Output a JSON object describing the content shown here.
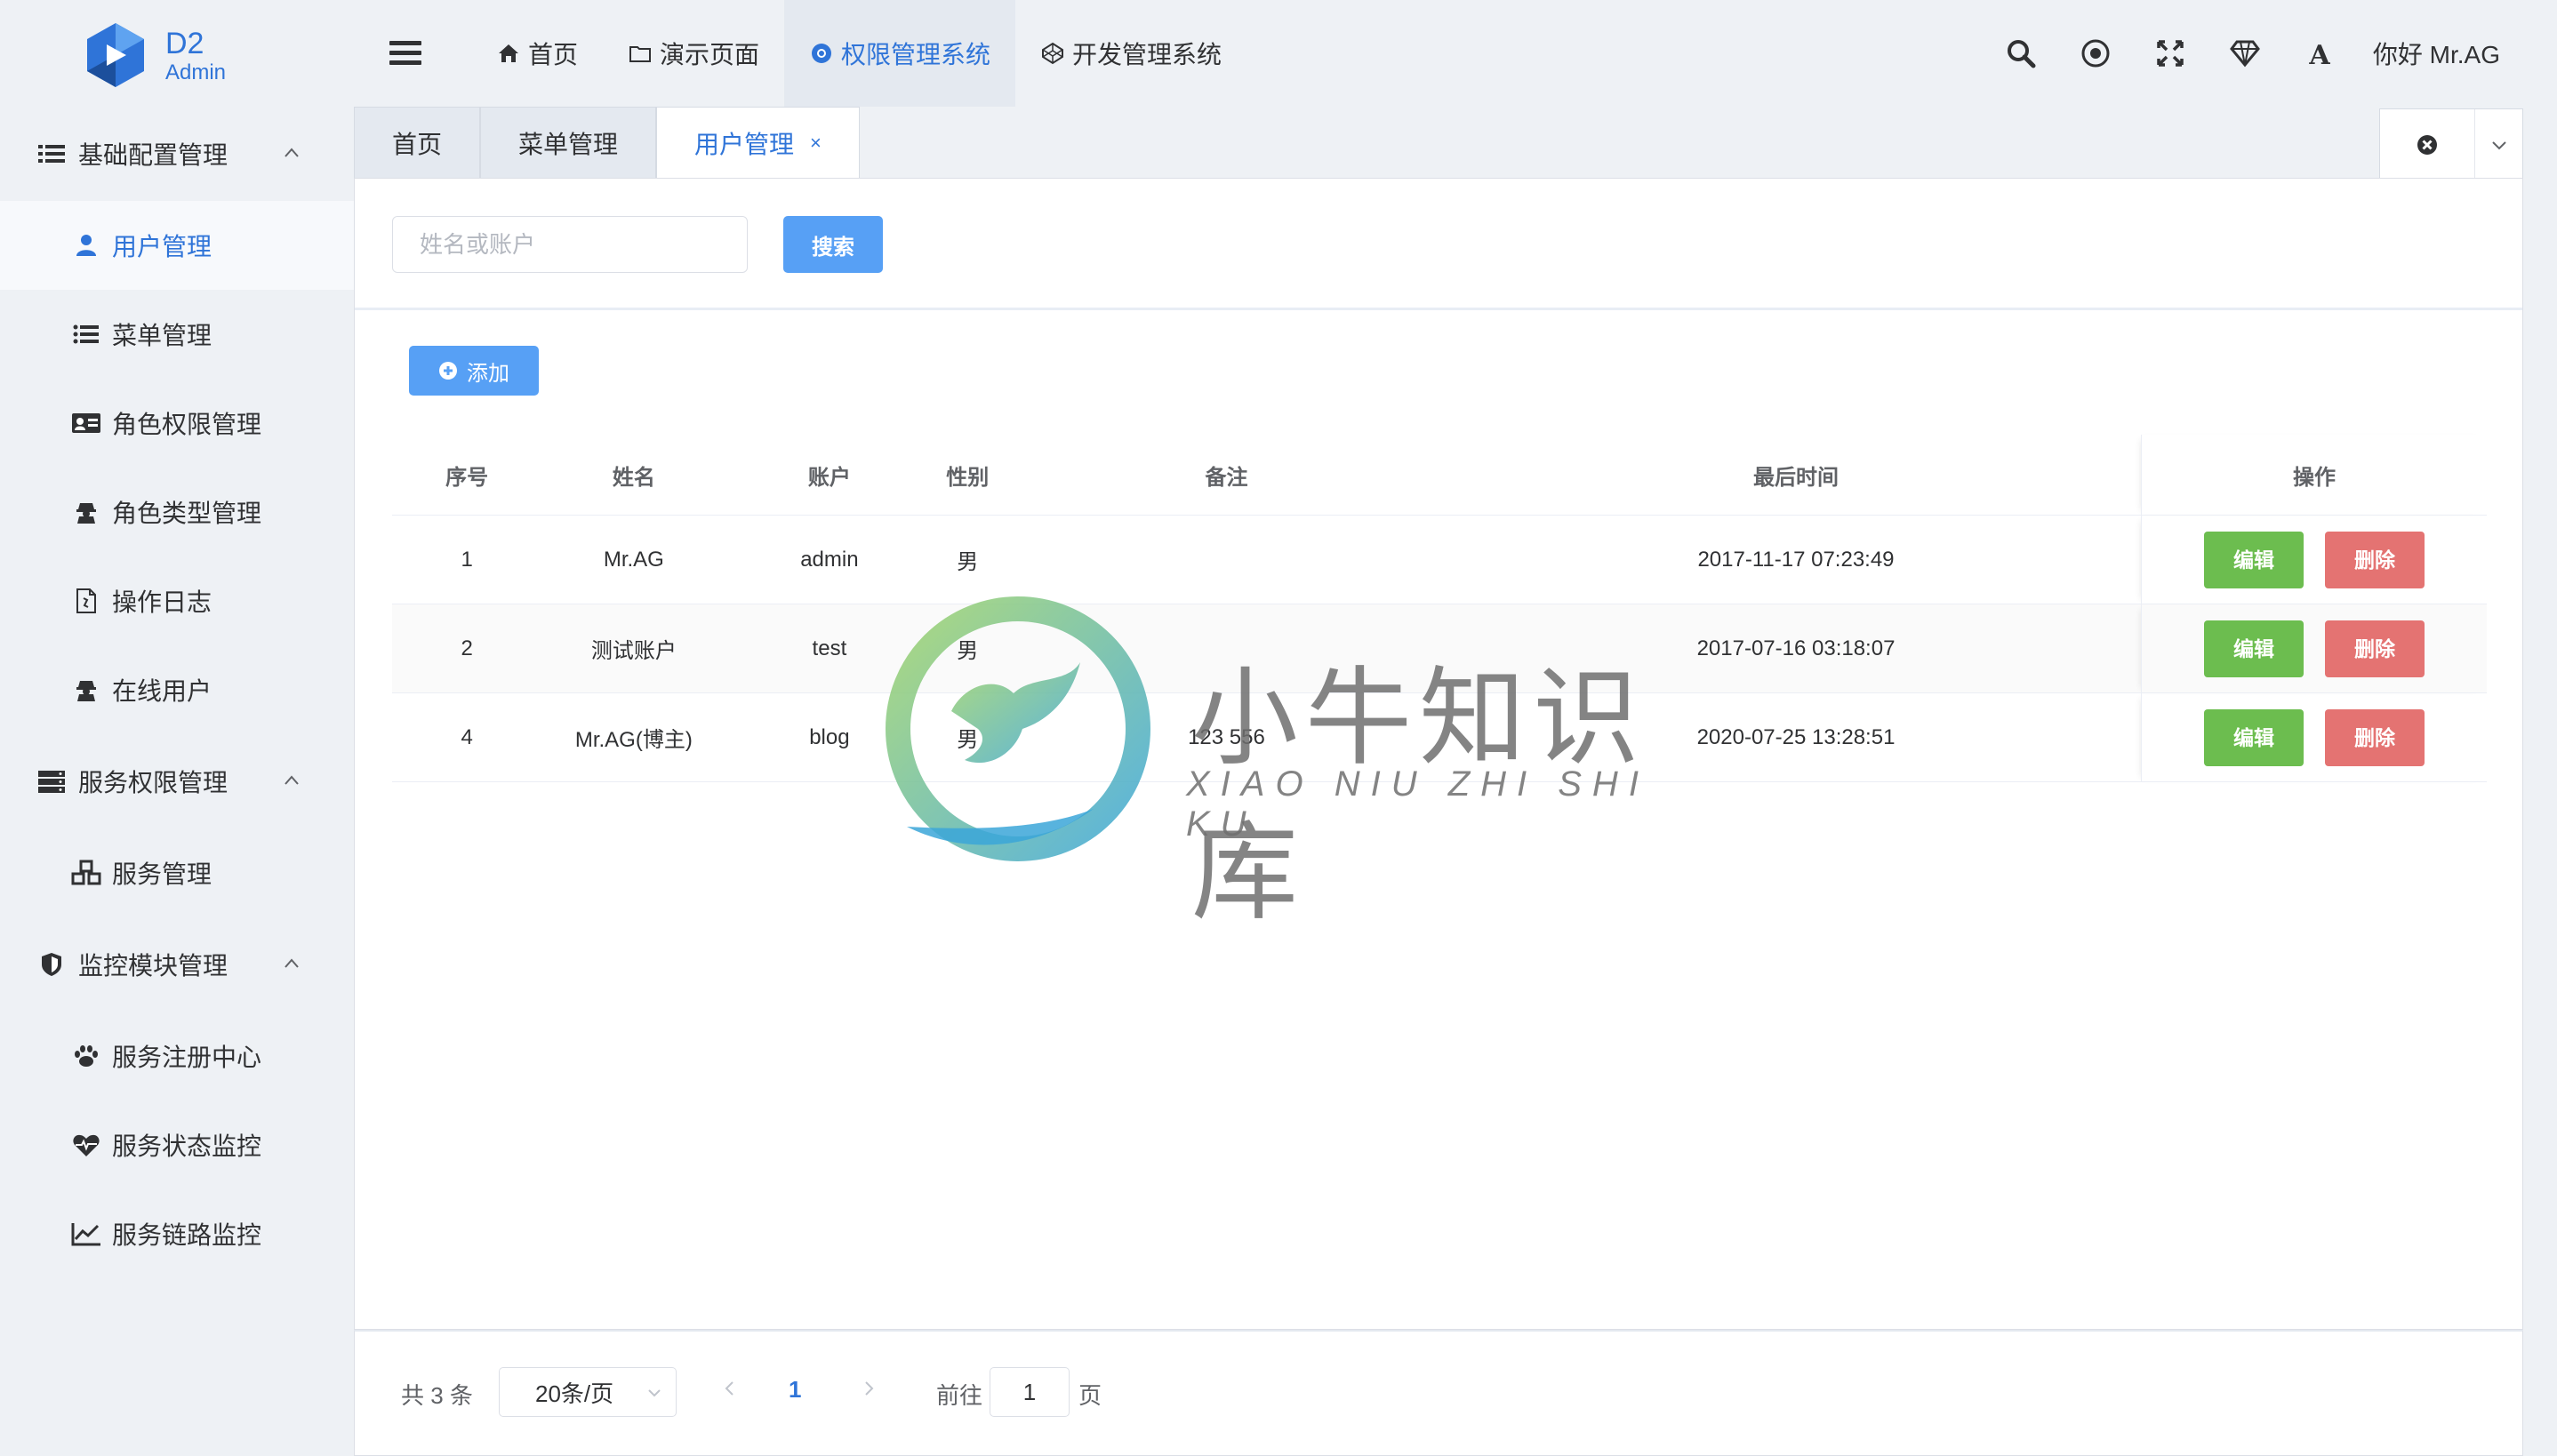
{
  "logo": {
    "title": "D2",
    "subtitle": "Admin"
  },
  "topmenu": [
    {
      "label": "首页",
      "icon": "home-icon"
    },
    {
      "label": "演示页面",
      "icon": "folder-icon"
    },
    {
      "label": "权限管理系统",
      "icon": "chrome-icon",
      "active": true
    },
    {
      "label": "开发管理系统",
      "icon": "codepen-icon"
    }
  ],
  "header": {
    "greeting": "你好 Mr.AG"
  },
  "sidebar": {
    "group1": {
      "label": "基础配置管理"
    },
    "items1": [
      {
        "label": "用户管理",
        "active": true
      },
      {
        "label": "菜单管理"
      },
      {
        "label": "角色权限管理"
      },
      {
        "label": "角色类型管理"
      },
      {
        "label": "操作日志"
      },
      {
        "label": "在线用户"
      }
    ],
    "group2": {
      "label": "服务权限管理"
    },
    "items2": [
      {
        "label": "服务管理"
      }
    ],
    "group3": {
      "label": "监控模块管理"
    },
    "items3": [
      {
        "label": "服务注册中心"
      },
      {
        "label": "服务状态监控"
      },
      {
        "label": "服务链路监控"
      }
    ]
  },
  "tabs": [
    {
      "label": "首页"
    },
    {
      "label": "菜单管理"
    },
    {
      "label": "用户管理",
      "active": true,
      "close": "×"
    }
  ],
  "search": {
    "placeholder": "姓名或账户",
    "button": "搜索"
  },
  "toolbar": {
    "add_label": "添加"
  },
  "table": {
    "headers": [
      "序号",
      "姓名",
      "账户",
      "性别",
      "备注",
      "最后时间",
      "操作"
    ],
    "rows": [
      {
        "id": "1",
        "name": "Mr.AG",
        "account": "admin",
        "gender": "男",
        "remark": "",
        "time": "2017-11-17 07:23:49"
      },
      {
        "id": "2",
        "name": "测试账户",
        "account": "test",
        "gender": "男",
        "remark": "",
        "time": "2017-07-16 03:18:07"
      },
      {
        "id": "4",
        "name": "Mr.AG(博主)",
        "account": "blog",
        "gender": "男",
        "remark": "123 556",
        "time": "2020-07-25 13:28:51"
      }
    ],
    "edit_label": "编辑",
    "delete_label": "删除"
  },
  "pagination": {
    "total": "共 3 条",
    "page_size": "20条/页",
    "current_page": "1",
    "goto_label": "前往",
    "goto_value": "1",
    "page_suffix": "页"
  },
  "watermark": {
    "title": "小牛知识库",
    "subtitle": "XIAO NIU ZHI SHI KU"
  },
  "colors": {
    "accent": "#2f74d8",
    "primary_button": "#57a0f5",
    "success": "#6cbd4f",
    "danger": "#e47372",
    "background": "#eef1f5"
  }
}
